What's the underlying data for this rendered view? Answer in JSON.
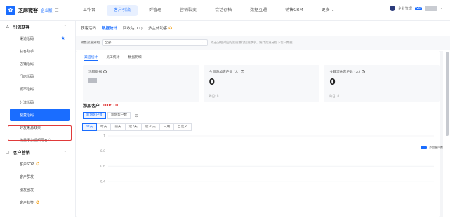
{
  "brand": {
    "name": "芝麻微客",
    "sub": "企业版"
  },
  "topnav": [
    "工作台",
    "客户引流",
    "群管理",
    "营销裂变",
    "会话存档",
    "数据互通",
    "销售CRM",
    "更多"
  ],
  "user": {
    "name": "企业管理",
    "badge": "V8"
  },
  "sidebar": {
    "group1": "引流获客",
    "group1_items": [
      "渠道活码",
      "获客助手",
      "店铺活码",
      "门店活码",
      "城市活码",
      "分流活码",
      "裂变活码",
      "好友来源效果",
      "批量添加视频号客户"
    ],
    "group2": "客户营销",
    "group2_items": [
      "客户SOP",
      "客户群发",
      "朋友圈发",
      "客户标签"
    ]
  },
  "subtabs": [
    "获客活码",
    "数据统计",
    "回收站(11)",
    "多主体助客"
  ],
  "filter": {
    "label": "销售渠道分组:",
    "value": "全部",
    "hint": "点击分组对应的渠道进行快速数字，统计渠道分组下客户数据"
  },
  "stat_tabs": [
    "渠道统计",
    "员工统计",
    "数据明细"
  ],
  "stat_cards": [
    {
      "title": "活码数据",
      "value": "",
      "sub": ""
    },
    {
      "title": "今日添加客户数 (人)",
      "value": "0",
      "sub": "昨日: 0"
    },
    {
      "title": "今日流失客户数 (人)",
      "value": "0",
      "sub": "昨日: 0"
    }
  ],
  "section": {
    "title": "添加客户",
    "badge": "TOP 10"
  },
  "segments": [
    "新增客户数",
    "新增客户数"
  ],
  "ranges": [
    "今天",
    "昨天",
    "前天",
    "近7天",
    "近30天",
    "日期",
    "自定义"
  ],
  "chart_data": {
    "type": "line",
    "x": [],
    "series": [
      {
        "name": "添加客户数",
        "values": []
      }
    ],
    "yticks": [
      1,
      0.8,
      0.6,
      0.4
    ],
    "ylim": [
      0,
      1
    ],
    "grid": true,
    "legend": "top-right"
  },
  "colors": {
    "accent": "#1a6dff",
    "danger": "#e03a3a",
    "medal": "#f5a623"
  }
}
